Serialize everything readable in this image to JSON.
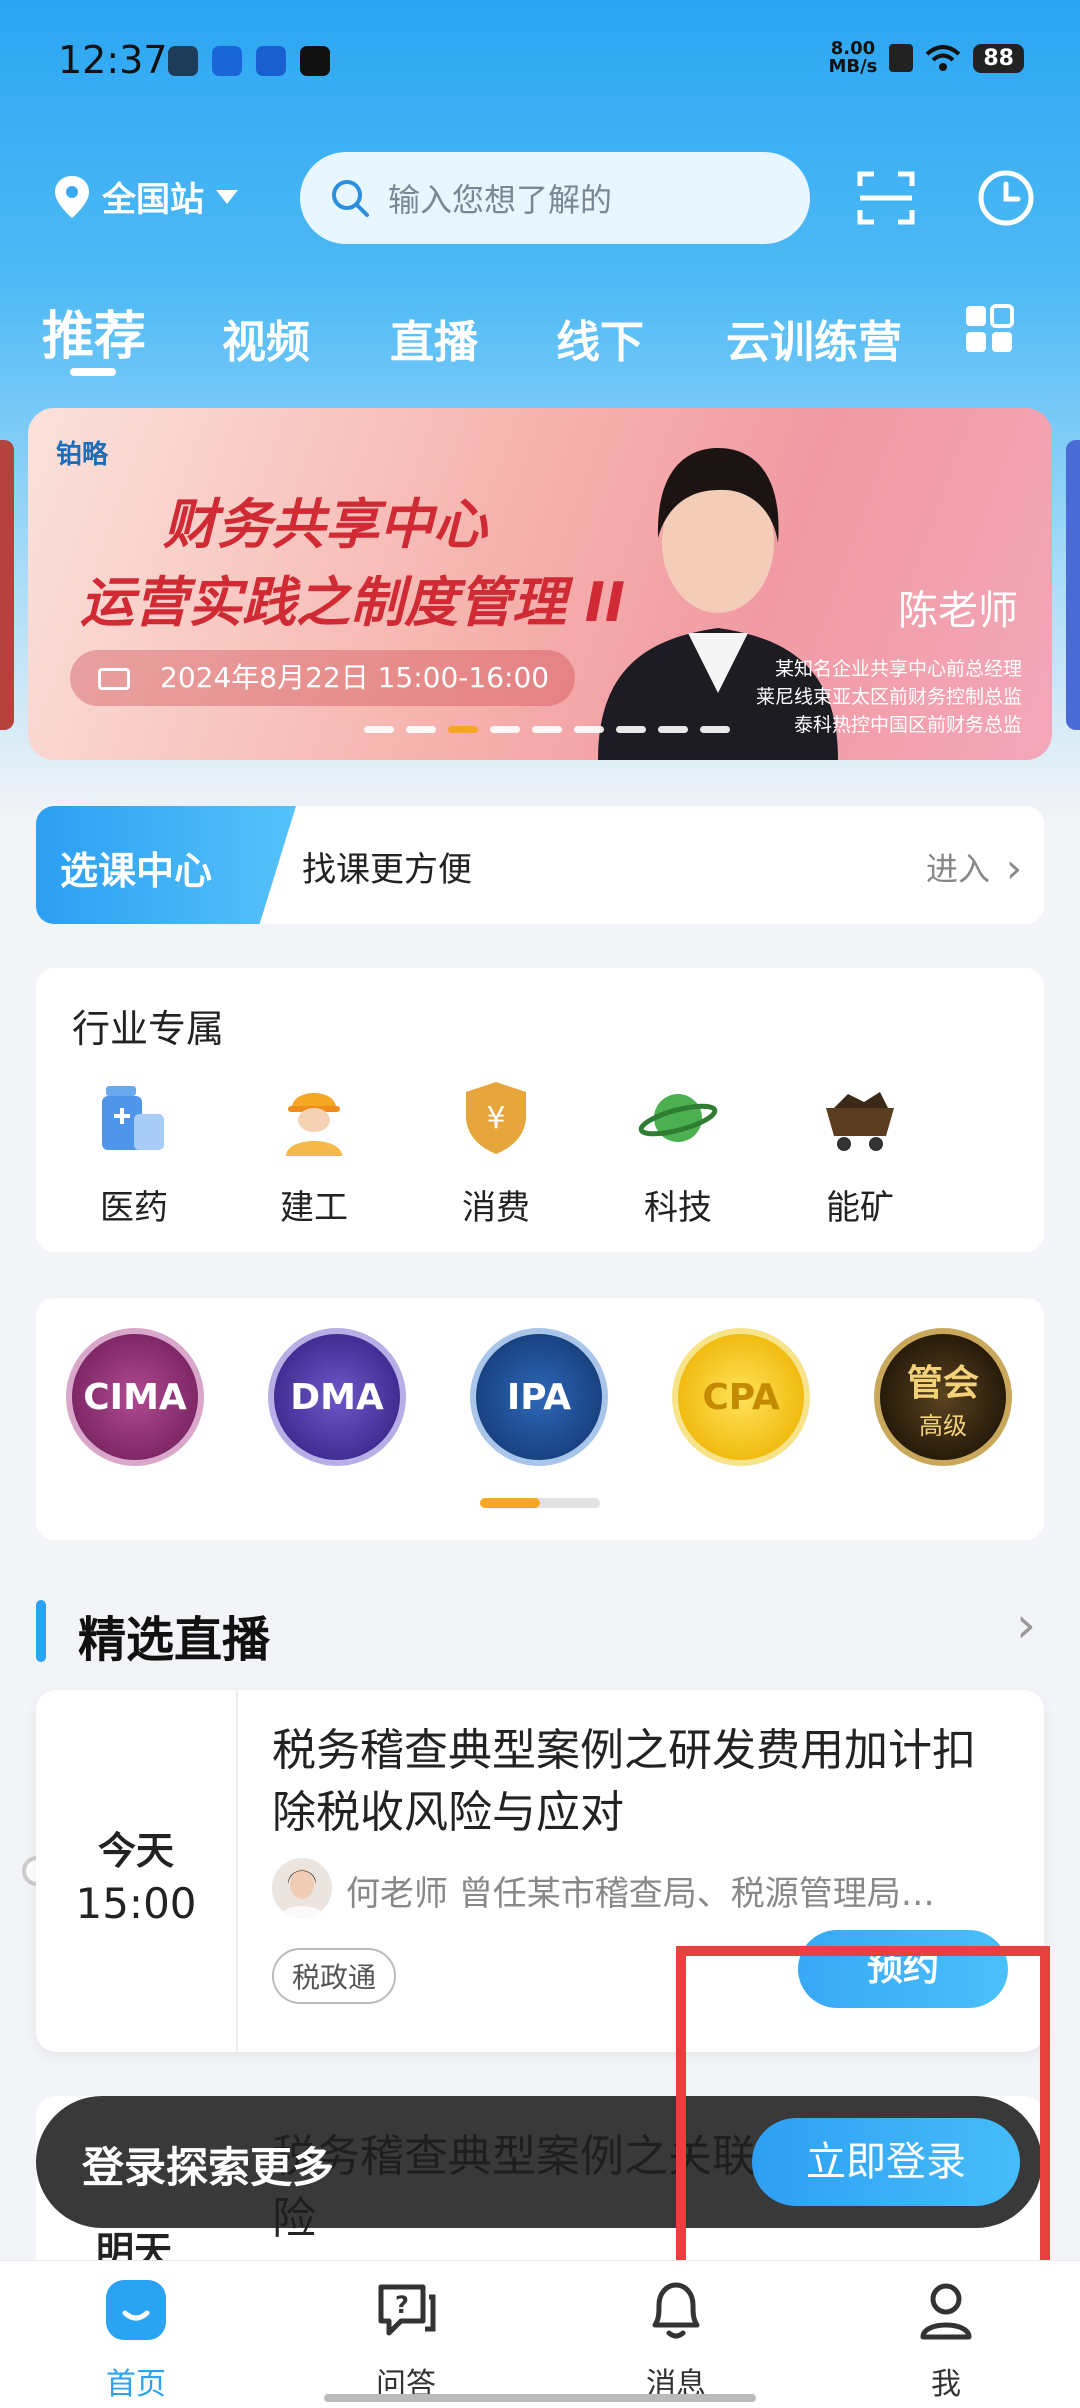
{
  "status": {
    "time": "12:37",
    "speed_value": "8.00",
    "speed_unit": "MB/s",
    "battery": "88"
  },
  "header": {
    "location": "全国站",
    "search_placeholder": "输入您想了解的"
  },
  "tabs": [
    "推荐",
    "视频",
    "直播",
    "线下",
    "云训练营"
  ],
  "banner": {
    "logo": "铂略",
    "title_line1": "财务共享中心",
    "title_line2": "运营实践之制度管理 II",
    "date": "2024年8月22日  15:00-16:00",
    "teacher": "陈老师",
    "roles": [
      "某知名企业共享中心前总经理",
      "莱尼线束亚太区前财务控制总监",
      "泰科热控中国区前财务总监"
    ]
  },
  "course_center": {
    "tag": "选课中心",
    "text": "找课更方便",
    "enter": "进入"
  },
  "industry": {
    "title": "行业专属",
    "items": [
      {
        "label": "医药",
        "icon": "medicine-icon"
      },
      {
        "label": "建工",
        "icon": "construction-worker-icon"
      },
      {
        "label": "消费",
        "icon": "yuan-shield-icon"
      },
      {
        "label": "科技",
        "icon": "planet-icon"
      },
      {
        "label": "能矿",
        "icon": "mine-cart-icon"
      }
    ]
  },
  "certs": [
    {
      "label": "CIMA",
      "color": "#8f2f77"
    },
    {
      "label": "DMA",
      "color": "#5a3fae"
    },
    {
      "label": "IPA",
      "color": "#1f4f9a"
    },
    {
      "label": "CPA",
      "color": "#f2c30f"
    },
    {
      "label": "管会",
      "sub": "高级",
      "color": "#3b2b12"
    }
  ],
  "live_section": {
    "title": "精选直播",
    "item1": {
      "day": "今天",
      "time": "15:00",
      "title": "税务稽查典型案例之研发费用加计扣除税收风险与应对",
      "teacher": "何老师  曾任某市稽查局、税源管理局…",
      "tag": "税政通",
      "action": "预约"
    },
    "item2": {
      "day": "明天",
      "title": "税务稽查典型案例之关联交易税收风险"
    }
  },
  "toast": {
    "text": "登录探索更多",
    "button": "立即登录"
  },
  "nav": [
    {
      "label": "首页",
      "icon": "home-icon",
      "active": true
    },
    {
      "label": "问答",
      "icon": "qa-icon",
      "active": false
    },
    {
      "label": "消息",
      "icon": "bell-icon",
      "active": false
    },
    {
      "label": "我",
      "icon": "profile-icon",
      "active": false
    }
  ]
}
